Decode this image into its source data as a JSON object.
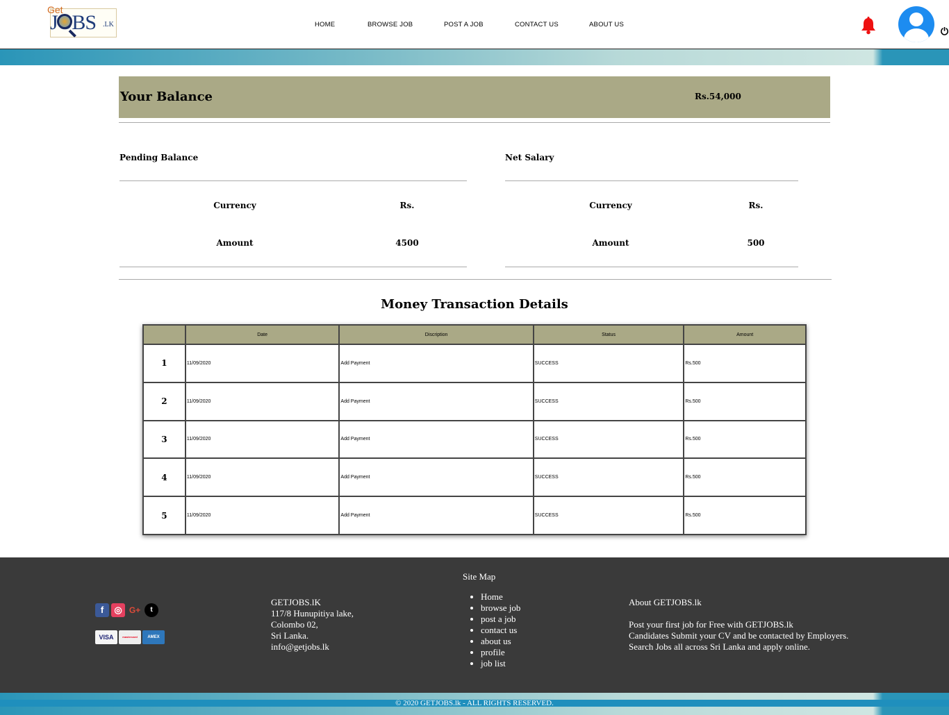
{
  "brand": {
    "logo_top": "Get",
    "logo_main": "JOBS",
    "logo_suffix": ".LK"
  },
  "nav": [
    {
      "label": "HOME"
    },
    {
      "label": "BROWSE JOB"
    },
    {
      "label": "POST A JOB"
    },
    {
      "label": "CONTACT US"
    },
    {
      "label": "ABOUT US"
    }
  ],
  "icons": {
    "notification": "bell-icon",
    "profile": "user-avatar-icon",
    "logout": "power-icon"
  },
  "colors": {
    "accent": "#aaa986",
    "bell": "#ee1111",
    "avatar": "#1d8cf0",
    "footer": "#3a3a3a"
  },
  "balance": {
    "label": "Your Balance",
    "value": "Rs.54,000"
  },
  "pending": {
    "title": "Pending Balance",
    "currency_label": "Currency",
    "currency_value": "Rs.",
    "amount_label": "Amount",
    "amount_value": "4500"
  },
  "net": {
    "title": "Net Salary",
    "currency_label": "Currency",
    "currency_value": "Rs.",
    "amount_label": "Amount",
    "amount_value": "500"
  },
  "transactions": {
    "title": "Money Transaction Details",
    "headers": [
      "",
      "Date",
      "Discription",
      "Status",
      "Amount"
    ],
    "rows": [
      {
        "no": "1",
        "date": "11/09/2020",
        "description": "Add Payment",
        "status": "SUCCESS",
        "amount": "Rs.500"
      },
      {
        "no": "2",
        "date": "11/09/2020",
        "description": "Add Payment",
        "status": "SUCCESS",
        "amount": "Rs.500"
      },
      {
        "no": "3",
        "date": "11/09/2020",
        "description": "Add Payment",
        "status": "SUCCESS",
        "amount": "Rs.500"
      },
      {
        "no": "4",
        "date": "11/09/2020",
        "description": "Add Payment",
        "status": "SUCCESS",
        "amount": "Rs.500"
      },
      {
        "no": "5",
        "date": "11/09/2020",
        "description": "Add Payment",
        "status": "SUCCESS",
        "amount": "Rs.500"
      }
    ]
  },
  "footer": {
    "social": [
      "facebook-icon",
      "instagram-icon",
      "google-plus-icon",
      "twitter-icon"
    ],
    "cards": [
      "VISA",
      "mastercard",
      "AMEX"
    ],
    "address": [
      "GETJOBS.lK",
      "117/8 Hunupitiya lake,",
      "Colombo 02,",
      "Sri Lanka.",
      "info@getjobs.lk"
    ],
    "sitemap_title": "Site Map",
    "sitemap": [
      "Home",
      "browse job",
      "post a job",
      "contact us",
      "about us",
      "profile",
      "job list"
    ],
    "about_title": "About GETJOBS.lk",
    "about_lines": [
      "Post your first job for Free with GETJOBS.lk",
      "Candidates Submit your CV and be contacted by Employers.",
      "Search Jobs all across Sri Lanka and apply online."
    ],
    "copyright": "© 2020 GETJOBS.lk - ALL RIGHTS RESERVED."
  }
}
